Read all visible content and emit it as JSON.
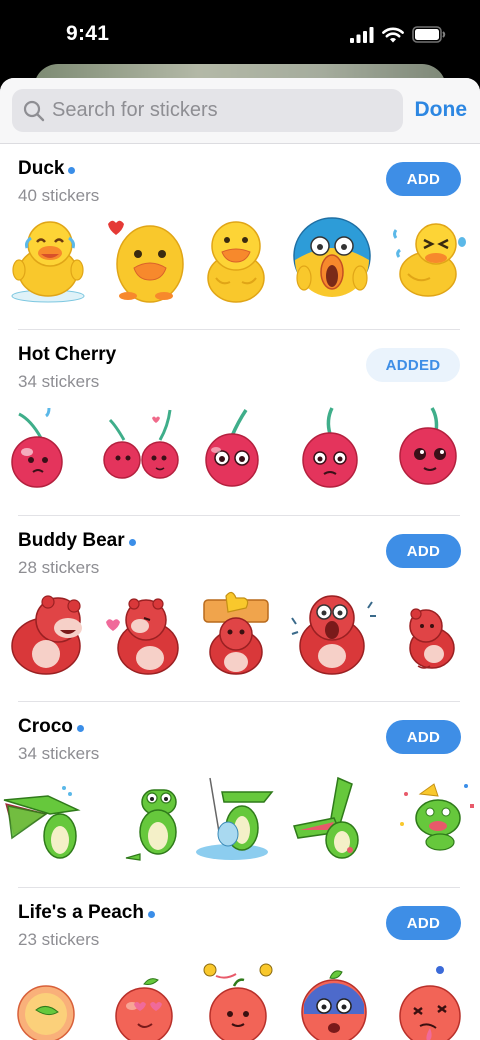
{
  "status_bar": {
    "time": "9:41",
    "icons": [
      "cellular-signal-icon",
      "wifi-icon",
      "battery-icon"
    ]
  },
  "search": {
    "placeholder": "Search for stickers",
    "done_label": "Done"
  },
  "packs": [
    {
      "title": "Duck",
      "count": "40 stickers",
      "button": "ADD",
      "is_new": true,
      "stickers": [
        "duck-crying-laughing",
        "duck-hearts",
        "duck-smiling",
        "duck-screaming",
        "duck-laughing"
      ]
    },
    {
      "title": "Hot Cherry",
      "count": "34 stickers",
      "button": "ADDED",
      "is_new": false,
      "stickers": [
        "cherry-sweating",
        "cherry-couple",
        "cherry-worried",
        "cherry-sad",
        "cherry-pleading"
      ]
    },
    {
      "title": "Buddy Bear",
      "count": "28 stickers",
      "button": "ADD",
      "is_new": true,
      "stickers": [
        "bear-laughing",
        "bear-blowing-kiss",
        "bear-thumbs-up",
        "bear-shocked",
        "bear-shy"
      ]
    },
    {
      "title": "Croco",
      "count": "34 stickers",
      "button": "ADD",
      "is_new": true,
      "stickers": [
        "croco-roaring",
        "croco-sitting",
        "croco-fishing",
        "croco-shouting",
        "croco-party"
      ]
    },
    {
      "title": "Life's a Peach",
      "count": "23 stickers",
      "button": "ADD",
      "is_new": true,
      "stickers": [
        "peach-halved",
        "peach-in-love",
        "peach-with-bees",
        "peach-blue-face",
        "peach-dizzy"
      ]
    }
  ],
  "colors": {
    "accent": "#3e8ee6",
    "duck": "#f9c82c",
    "cherry": "#e4345c",
    "bear": "#d9383a",
    "croco": "#66c83c",
    "peach": "#f26457"
  }
}
